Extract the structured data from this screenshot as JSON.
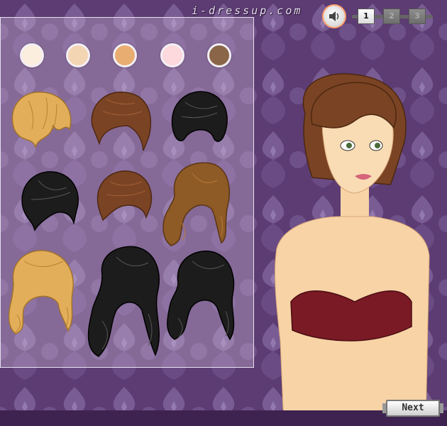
{
  "site": {
    "logo_text": "i-dressup.com"
  },
  "pager": {
    "pages": [
      "1",
      "2",
      "3"
    ],
    "active_page": "1"
  },
  "colors": {
    "background": "#5a3a6e",
    "accent": "#ff9e6b",
    "skin_tones": [
      "#fbeede",
      "#f4d5b3",
      "#e8ad70",
      "#fdd8dc",
      "#8a6548"
    ]
  },
  "hair_styles": [
    {
      "color": "#e3ae5a"
    },
    {
      "color": "#7a4424"
    },
    {
      "color": "#1c1c1c"
    },
    {
      "color": "#1c1c1c"
    },
    {
      "color": "#7a4424"
    },
    {
      "color": "#8e5a26"
    },
    {
      "color": "#e3ae5a"
    },
    {
      "color": "#1c1c1c"
    },
    {
      "color": "#1c1c1c"
    }
  ],
  "buttons": {
    "next_label": "Next"
  },
  "icons": {
    "sound": "speaker-icon"
  }
}
